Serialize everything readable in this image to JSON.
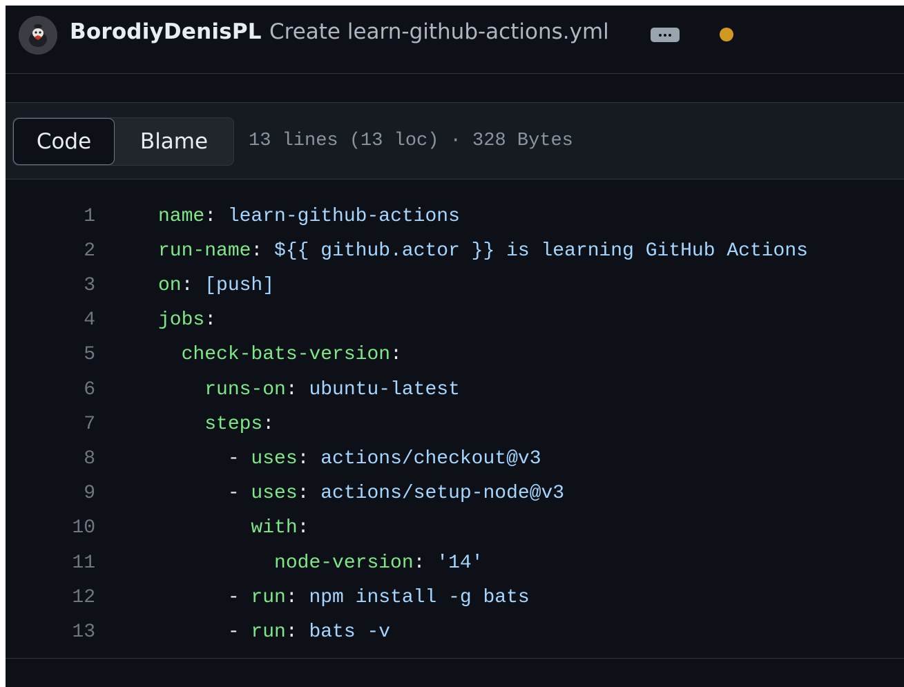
{
  "commit": {
    "author": "BorodiyDenisPL",
    "message": "Create learn-github-actions.yml"
  },
  "toolbar": {
    "code_label": "Code",
    "blame_label": "Blame",
    "file_meta": "13 lines (13 loc) · 328 Bytes"
  },
  "colors": {
    "background": "#0d1117",
    "key": "#7ee787",
    "value": "#a5d6ff",
    "status_dot": "#d29922"
  },
  "icons": {
    "ellipsis": "kebab-horizontal-icon",
    "status": "pending-status-dot-icon",
    "avatar": "user-avatar"
  },
  "code_lines": [
    {
      "num": "1",
      "indent": "",
      "dash": "",
      "key": "name",
      "value": "learn-github-actions"
    },
    {
      "num": "2",
      "indent": "",
      "dash": "",
      "key": "run-name",
      "value": "${{ github.actor }} is learning GitHub Actions"
    },
    {
      "num": "3",
      "indent": "",
      "dash": "",
      "key": "on",
      "value": "[push]"
    },
    {
      "num": "4",
      "indent": "",
      "dash": "",
      "key": "jobs",
      "value": ""
    },
    {
      "num": "5",
      "indent": "  ",
      "dash": "",
      "key": "check-bats-version",
      "value": ""
    },
    {
      "num": "6",
      "indent": "    ",
      "dash": "",
      "key": "runs-on",
      "value": "ubuntu-latest"
    },
    {
      "num": "7",
      "indent": "    ",
      "dash": "",
      "key": "steps",
      "value": ""
    },
    {
      "num": "8",
      "indent": "      ",
      "dash": "- ",
      "key": "uses",
      "value": "actions/checkout@v3"
    },
    {
      "num": "9",
      "indent": "      ",
      "dash": "- ",
      "key": "uses",
      "value": "actions/setup-node@v3"
    },
    {
      "num": "10",
      "indent": "        ",
      "dash": "",
      "key": "with",
      "value": ""
    },
    {
      "num": "11",
      "indent": "          ",
      "dash": "",
      "key": "node-version",
      "value": "'14'"
    },
    {
      "num": "12",
      "indent": "      ",
      "dash": "- ",
      "key": "run",
      "value": "npm install -g bats"
    },
    {
      "num": "13",
      "indent": "      ",
      "dash": "- ",
      "key": "run",
      "value": "bats -v"
    }
  ]
}
